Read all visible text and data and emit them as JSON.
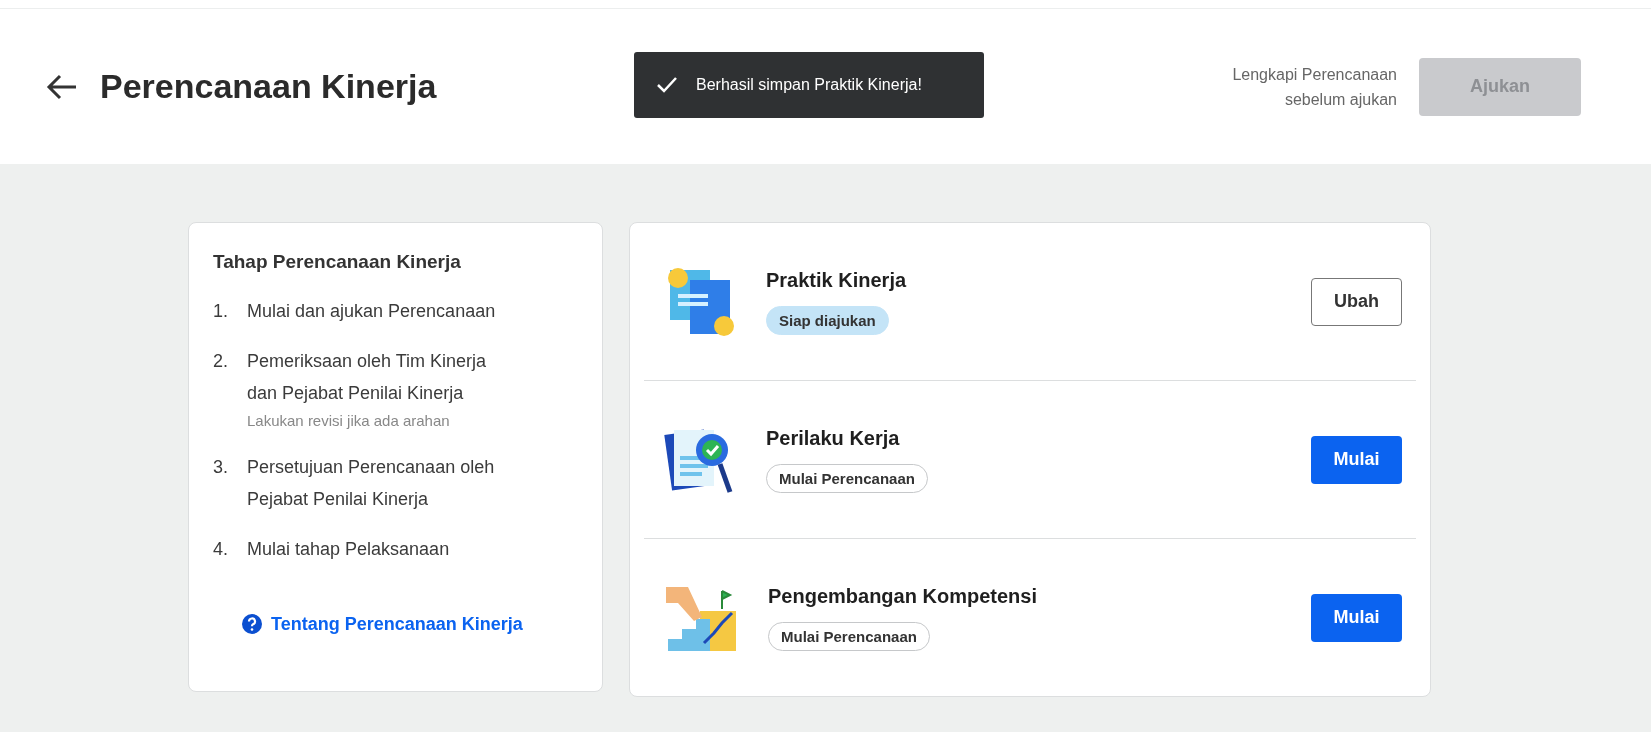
{
  "header": {
    "title": "Perencanaan Kinerja",
    "hint_lines": [
      "Lengkapi Perencanaan",
      "sebelum ajukan"
    ],
    "submit": {
      "label": "Ajukan",
      "disabled": true
    }
  },
  "toast": {
    "message": "Berhasil simpan Praktik Kinerja!"
  },
  "steps_card": {
    "title": "Tahap Perencanaan Kinerja",
    "steps": [
      {
        "number": "1.",
        "lines": [
          "Mulai dan ajukan Perencanaan"
        ]
      },
      {
        "number": "2.",
        "lines": [
          "Pemeriksaan oleh Tim Kinerja",
          "dan Pejabat Penilai Kinerja"
        ],
        "note": "Lakukan revisi jika ada arahan"
      },
      {
        "number": "3.",
        "lines": [
          "Persetujuan Perencanaan oleh",
          "Pejabat Penilai Kinerja"
        ]
      },
      {
        "number": "4.",
        "lines": [
          "Mulai tahap Pelaksanaan"
        ]
      }
    ],
    "link": "Tentang Perencanaan Kinerja"
  },
  "sections": [
    {
      "kind": "practice",
      "title": "Praktik Kinerja",
      "status": {
        "kind": "ready",
        "label": "Siap diajukan"
      },
      "action": {
        "kind": "outline",
        "label": "Ubah"
      }
    },
    {
      "kind": "behavior",
      "title": "Perilaku Kerja",
      "status": {
        "kind": "start",
        "label": "Mulai Perencanaan"
      },
      "action": {
        "kind": "primary",
        "label": "Mulai"
      }
    },
    {
      "kind": "development",
      "title": "Pengembangan Kompetensi",
      "status": {
        "kind": "start",
        "label": "Mulai Perencanaan"
      },
      "action": {
        "kind": "primary",
        "label": "Mulai"
      }
    }
  ]
}
